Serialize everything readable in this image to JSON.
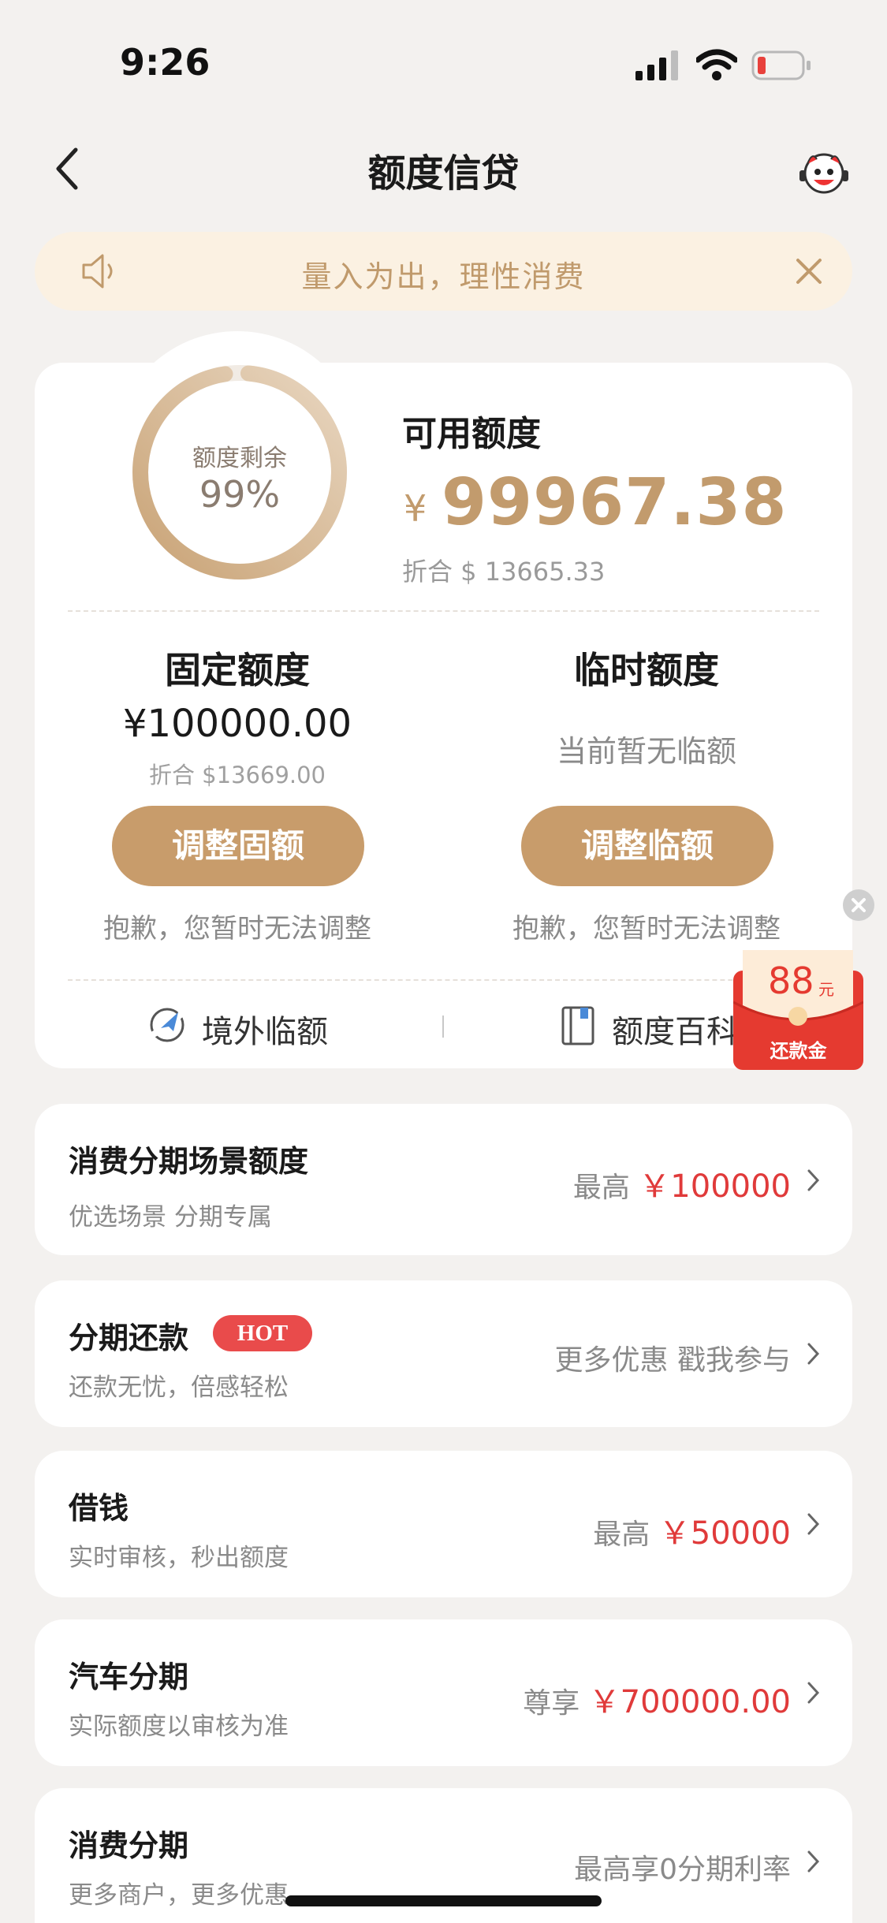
{
  "status_bar": {
    "time": "9:26"
  },
  "header": {
    "title": "额度信贷"
  },
  "notice": {
    "text": "量入为出，理性消费"
  },
  "credit": {
    "ring_label": "额度剩余",
    "ring_percent": "99%",
    "remaining_fraction": 0.99,
    "available_label": "可用额度",
    "currency": "¥",
    "available_amount": "99967.38",
    "available_converted": "折合 $ 13665.33"
  },
  "fixed": {
    "title": "固定额度",
    "amount": "¥100000.00",
    "converted": "折合 $13669.00",
    "button": "调整固额",
    "note": "抱歉，您暂时无法调整"
  },
  "temporary": {
    "title": "临时额度",
    "status": "当前暂无临额",
    "button": "调整临额",
    "note": "抱歉，您暂时无法调整"
  },
  "links": {
    "overseas": "境外临额",
    "encyclopedia": "额度百科"
  },
  "red_packet": {
    "amount": "88",
    "unit": "元",
    "label": "还款金"
  },
  "cards": [
    {
      "title": "消费分期场景额度",
      "subtitle": "优选场景 分期专属",
      "right_prefix": "最高 ",
      "right_value": "￥100000"
    },
    {
      "title": "分期还款",
      "badge": "HOT",
      "subtitle": "还款无忧，倍感轻松",
      "right_prefix": "更多优惠 戳我参与",
      "right_value": ""
    },
    {
      "title": "借钱",
      "subtitle": "实时审核，秒出额度",
      "right_prefix": "最高 ",
      "right_value": "￥50000"
    },
    {
      "title": "汽车分期",
      "subtitle": "实际额度以审核为准",
      "right_prefix": "尊享 ",
      "right_value": "￥700000.00"
    },
    {
      "title": "消费分期",
      "subtitle": "更多商户，更多优惠",
      "right_prefix": "最高享0分期利率",
      "right_value": ""
    }
  ],
  "colors": {
    "accent": "#c89c6b",
    "red": "#e03a3a",
    "notice_bg": "#fbf1e2"
  }
}
